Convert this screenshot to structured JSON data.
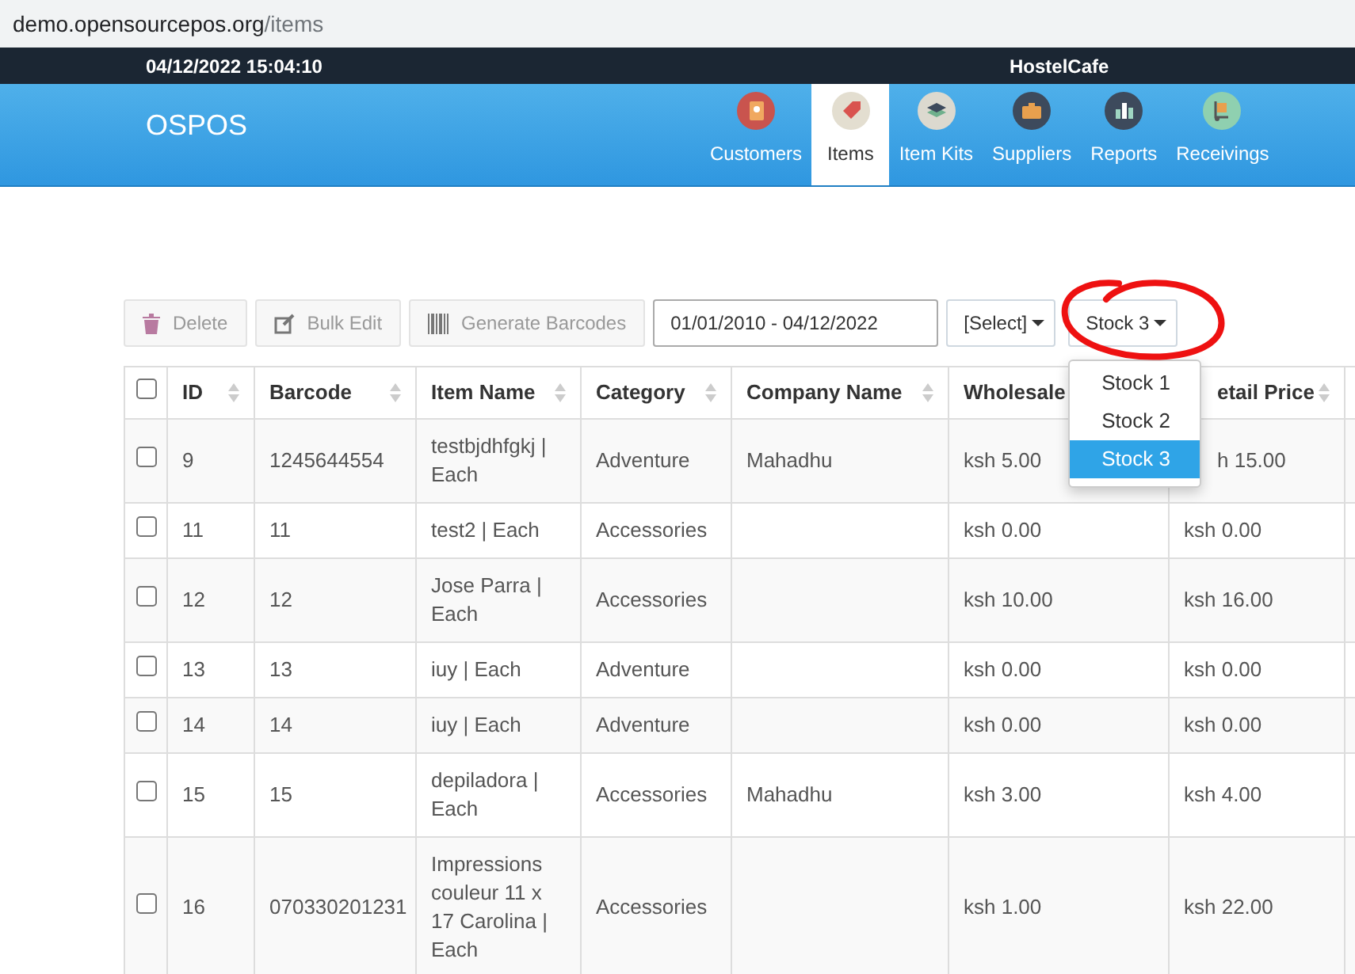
{
  "address_bar": {
    "host": "demo.opensourcepos.org",
    "path": "/items"
  },
  "top_bar": {
    "datetime": "04/12/2022 15:04:10",
    "store": "HostelCafe"
  },
  "brand": "OSPOS",
  "nav": [
    {
      "label": "Customers",
      "selected": false
    },
    {
      "label": "Items",
      "selected": true
    },
    {
      "label": "Item Kits",
      "selected": false
    },
    {
      "label": "Suppliers",
      "selected": false
    },
    {
      "label": "Reports",
      "selected": false
    },
    {
      "label": "Receivings",
      "selected": false
    }
  ],
  "toolbar": {
    "delete": "Delete",
    "bulk_edit": "Bulk Edit",
    "barcodes": "Generate Barcodes",
    "date_range": "01/01/2010 - 04/12/2022",
    "filter": "[Select]",
    "stock": "Stock 3"
  },
  "stock_menu": [
    {
      "label": "Stock 1",
      "selected": false
    },
    {
      "label": "Stock 2",
      "selected": false
    },
    {
      "label": "Stock 3",
      "selected": true
    }
  ],
  "table": {
    "select_all": {
      "checked": false
    },
    "columns": [
      "ID",
      "Barcode",
      "Item Name",
      "Category",
      "Company Name",
      "Wholesale",
      "etail Price"
    ],
    "rows": [
      {
        "checked": false,
        "cells": [
          "9",
          "1245644554",
          "testbjdhfgkj | Each",
          "Adventure",
          "Mahadhu",
          "ksh 5.00",
          "h 15.00"
        ]
      },
      {
        "checked": false,
        "cells": [
          "11",
          "11",
          "test2 | Each",
          "Accessories",
          "",
          "ksh 0.00",
          "ksh 0.00"
        ]
      },
      {
        "checked": false,
        "cells": [
          "12",
          "12",
          "Jose Parra | Each",
          "Accessories",
          "",
          "ksh 10.00",
          "ksh 16.00"
        ]
      },
      {
        "checked": false,
        "cells": [
          "13",
          "13",
          "iuy | Each",
          "Adventure",
          "",
          "ksh 0.00",
          "ksh 0.00"
        ]
      },
      {
        "checked": false,
        "cells": [
          "14",
          "14",
          "iuy | Each",
          "Adventure",
          "",
          "ksh 0.00",
          "ksh 0.00"
        ]
      },
      {
        "checked": false,
        "cells": [
          "15",
          "15",
          "depiladora | Each",
          "Accessories",
          "Mahadhu",
          "ksh 3.00",
          "ksh 4.00"
        ]
      },
      {
        "checked": false,
        "cells": [
          "16",
          "070330201231",
          "Impressions couleur 11 x 17 Carolina | Each",
          "Accessories",
          "",
          "ksh 1.00",
          "ksh 22.00"
        ]
      }
    ]
  }
}
